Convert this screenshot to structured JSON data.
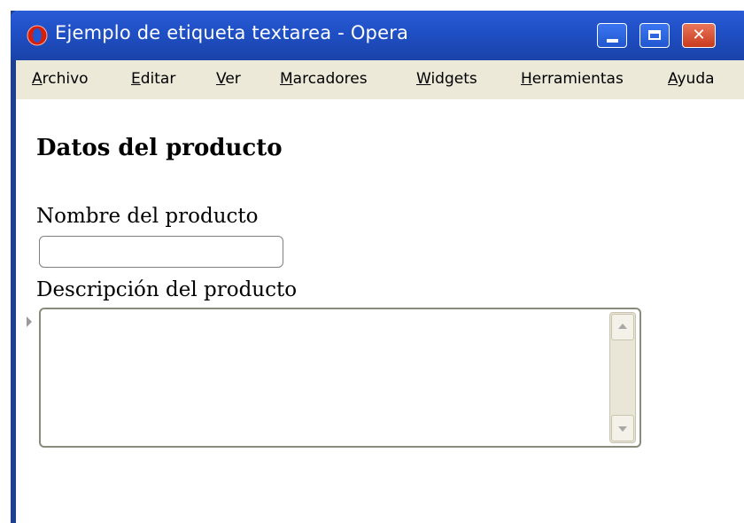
{
  "window": {
    "title": "Ejemplo de etiqueta textarea - Opera",
    "icon": "opera-logo-icon",
    "controls": {
      "minimize": "minimize-icon",
      "maximize": "maximize-icon",
      "close": "close-icon",
      "close_glyph": "✕"
    },
    "colors": {
      "titlebar": "#2157d0",
      "close_button": "#c83a1e",
      "menubar": "#ece9d8"
    }
  },
  "menu": {
    "items": [
      "Archivo",
      "Editar",
      "Ver",
      "Marcadores",
      "Widgets",
      "Herramientas",
      "Ayuda"
    ]
  },
  "form": {
    "heading": "Datos del producto",
    "name_label": "Nombre del producto",
    "name_value": "",
    "description_label": "Descripción del producto",
    "description_value": ""
  }
}
